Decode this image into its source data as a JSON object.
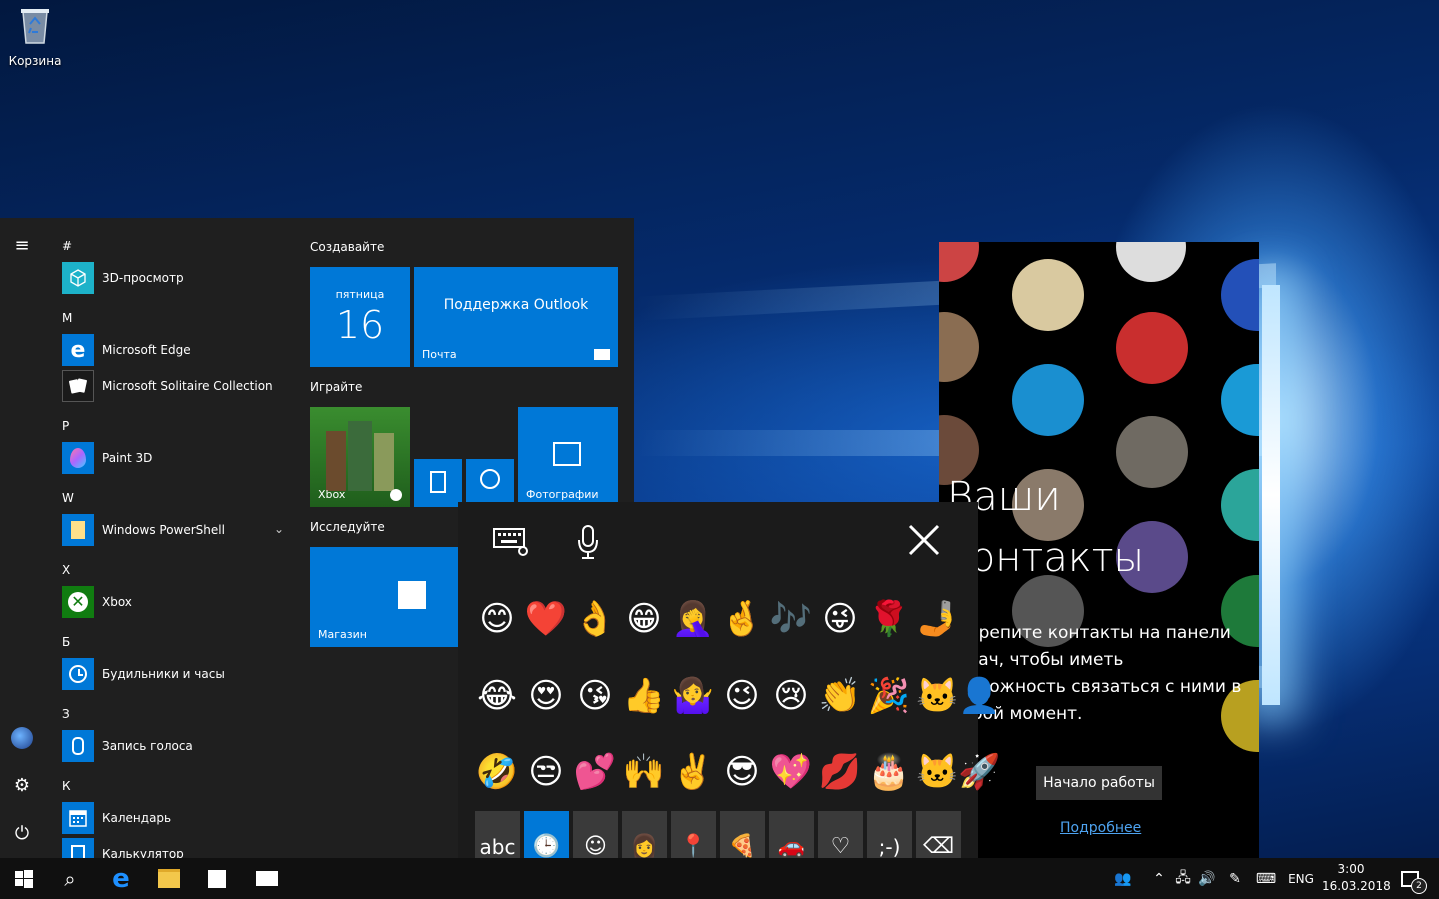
{
  "desktop": {
    "recycle_bin_label": "Корзина"
  },
  "start_menu": {
    "letters": [
      "#",
      "M",
      "P",
      "W",
      "X",
      "Б",
      "З",
      "К"
    ],
    "apps": [
      {
        "name": "3D-просмотр",
        "color": "#1db2c9",
        "icon": "cube-icon"
      },
      {
        "name": "Microsoft Edge",
        "color": "#0078d7",
        "icon": "edge-icon"
      },
      {
        "name": "Microsoft Solitaire Collection",
        "color": "#1a1a1a",
        "icon": "cards-icon"
      },
      {
        "name": "Paint 3D",
        "color": "#0078d7",
        "icon": "paint3d-icon"
      },
      {
        "name": "Windows PowerShell",
        "color": "#0078d7",
        "icon": "folder-icon"
      },
      {
        "name": "Xbox",
        "color": "#107c10",
        "icon": "xbox-icon"
      },
      {
        "name": "Будильники и часы",
        "color": "#0078d7",
        "icon": "clock-icon"
      },
      {
        "name": "Запись голоса",
        "color": "#0078d7",
        "icon": "microphone-icon"
      },
      {
        "name": "Календарь",
        "color": "#0078d7",
        "icon": "calendar-icon"
      },
      {
        "name": "Калькулятор",
        "color": "#0078d7",
        "icon": "calculator-icon"
      }
    ],
    "groups": {
      "create": "Создавайте",
      "play": "Играйте",
      "explore": "Исследуйте"
    },
    "tiles": {
      "calendar_day": "пятница",
      "calendar_date": "16",
      "outlook_title": "Поддержка Outlook",
      "mail_label": "Почта",
      "xbox_label": "Xbox",
      "photos_label": "Фотографии",
      "store_label": "Магазин"
    }
  },
  "emoji_panel": {
    "rows": [
      [
        "😊",
        "❤️",
        "👌",
        "😁",
        "🤦‍♀️",
        "🤞",
        "🎶",
        "😜",
        "🌹",
        "🤳"
      ],
      [
        "😂",
        "😍",
        "😘",
        "👍",
        "🤷‍♀️",
        "😉",
        "😢",
        "👏",
        "🎉",
        "🐱‍👤"
      ],
      [
        "🤣",
        "😒",
        "💕",
        "🙌",
        "✌️",
        "😎",
        "💖",
        "💋",
        "🎂",
        "🐱‍🚀"
      ]
    ],
    "categories": [
      "abc",
      "🕒",
      "☺",
      "👩",
      "📍",
      "🍕",
      "🚗",
      "♡",
      ";-)",
      "⌫"
    ],
    "selected_category": 1
  },
  "people_panel": {
    "title_line1": "Ваши",
    "title_line2": "контакты",
    "description": "Закрепите контакты на панели задач, чтобы иметь возможность связаться с ними в любой момент.",
    "start_button": "Начало работы",
    "learn_more": "Подробнее"
  },
  "taskbar": {
    "language": "ENG",
    "time": "3:00",
    "date": "16.03.2018",
    "notification_count": "2"
  }
}
